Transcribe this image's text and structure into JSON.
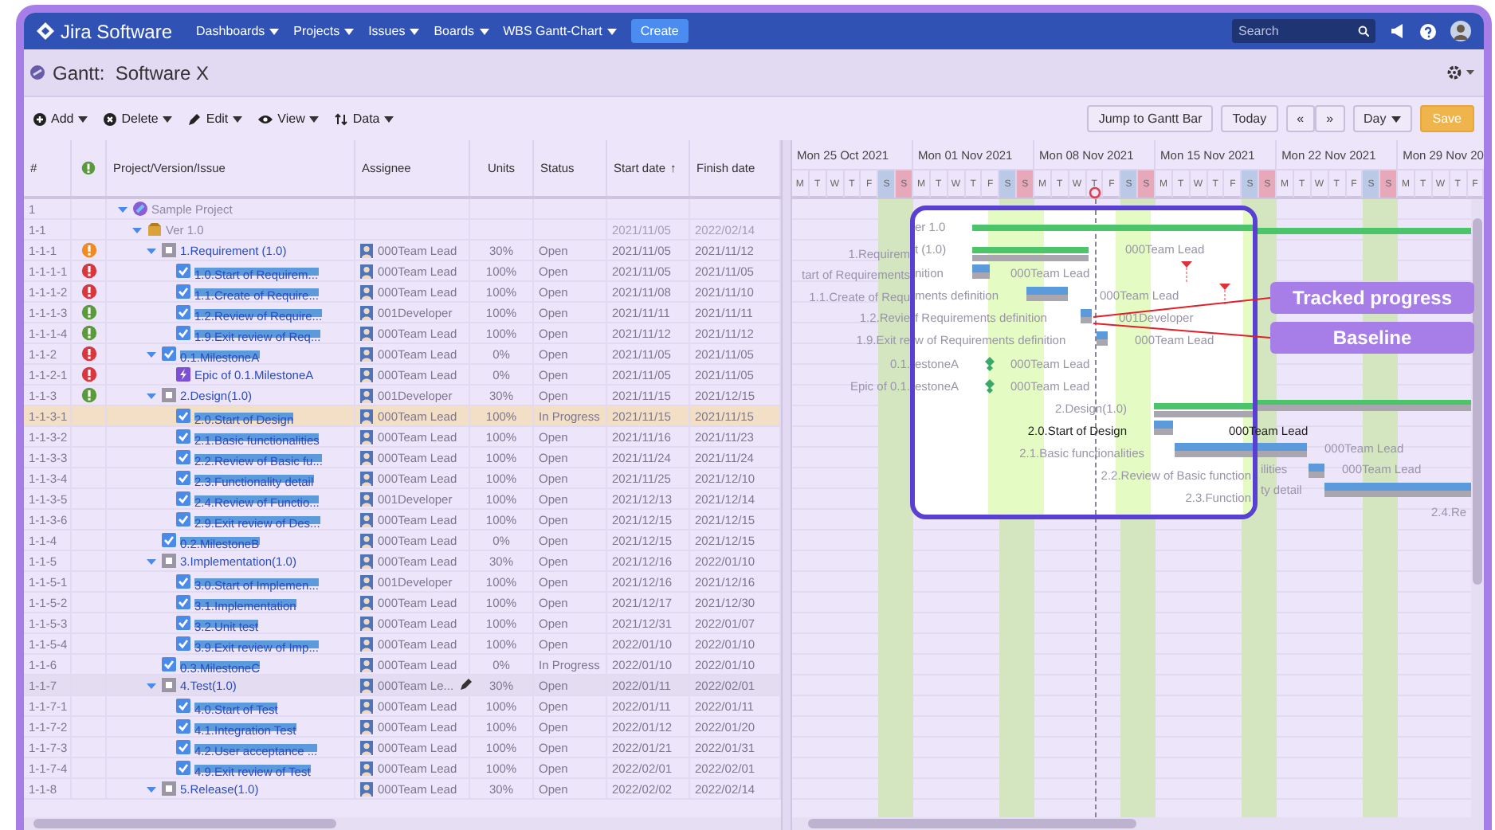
{
  "nav": {
    "product": "Jira Software",
    "menus": [
      {
        "label": "Dashboards"
      },
      {
        "label": "Projects"
      },
      {
        "label": "Issues"
      },
      {
        "label": "Boards"
      },
      {
        "label": "WBS Gantt-Chart"
      }
    ],
    "create_button": "Create",
    "search": {
      "placeholder": "Search"
    }
  },
  "page": {
    "title": "Gantt:  Software X"
  },
  "toolbar": {
    "menus": [
      {
        "kind": "add",
        "label": "Add"
      },
      {
        "kind": "delete",
        "label": "Delete"
      },
      {
        "kind": "edit",
        "label": "Edit"
      },
      {
        "kind": "view",
        "label": "View"
      },
      {
        "kind": "data",
        "label": "Data"
      }
    ],
    "jump_button": "Jump to Gantt Bar",
    "today_button": "Today",
    "prev_button": "«",
    "next_button": "»",
    "scale": "Day",
    "save_button": "Save"
  },
  "table": {
    "columns": [
      {
        "kind": "number",
        "label": "#"
      },
      {
        "kind": "priority"
      },
      {
        "kind": "issue",
        "label": "Project/Version/Issue"
      },
      {
        "kind": "assignee",
        "label": "Assignee"
      },
      {
        "kind": "units",
        "label": "Units"
      },
      {
        "kind": "status",
        "label": "Status"
      },
      {
        "kind": "start",
        "label": "Start date",
        "sort": "↑"
      },
      {
        "kind": "finish",
        "label": "Finish date"
      }
    ],
    "rows": [
      {
        "num": "1",
        "kind": "project",
        "name": "Sample Project",
        "expanded": true,
        "selected": false,
        "hovered": false,
        "children": [
          {
            "num": "1-1",
            "kind": "version",
            "name": "Ver 1.0",
            "expanded": true,
            "start": "2021/11/05",
            "finish": "2022/02/14",
            "selected": false,
            "hovered": false,
            "children": [
              {
                "num": "1-1-1",
                "color": "#f08a24",
                "kind": "folder",
                "name": "1.Requirement (1.0)",
                "expanded": true,
                "assignee": "000Team Lead",
                "units": "30%",
                "status": "Open",
                "start": "2021/11/05",
                "finish": "2021/11/12",
                "selected": false,
                "hovered": false,
                "children": [
                  {
                    "num": "1-1-1-1",
                    "color": "#d9373e",
                    "kind": "task",
                    "name": "1.0.Start of Requirem...",
                    "assignee": "000Team Lead",
                    "units": "100%",
                    "status": "Open",
                    "start": "2021/11/05",
                    "finish": "2021/11/05",
                    "selected": false,
                    "hovered": false
                  },
                  {
                    "num": "1-1-1-2",
                    "color": "#d9373e",
                    "kind": "task",
                    "name": "1.1.Create of Require...",
                    "assignee": "000Team Lead",
                    "units": "100%",
                    "status": "Open",
                    "start": "2021/11/08",
                    "finish": "2021/11/10",
                    "selected": false,
                    "hovered": false
                  },
                  {
                    "num": "1-1-1-3",
                    "color": "#5a9a3a",
                    "kind": "task",
                    "name": "1.2.Review of Require...",
                    "assignee": "001Developer",
                    "units": "100%",
                    "status": "Open",
                    "start": "2021/11/11",
                    "finish": "2021/11/11",
                    "selected": false,
                    "hovered": false
                  },
                  {
                    "num": "1-1-1-4",
                    "color": "#5a9a3a",
                    "kind": "task",
                    "name": "1.9.Exit review of Req...",
                    "assignee": "000Team Lead",
                    "units": "100%",
                    "status": "Open",
                    "start": "2021/11/12",
                    "finish": "2021/11/12",
                    "selected": false,
                    "hovered": false
                  }
                ]
              },
              {
                "num": "1-1-2",
                "color": "#d9373e",
                "kind": "task",
                "name": "0.1.MilestoneA",
                "expanded": true,
                "assignee": "000Team Lead",
                "units": "0%",
                "status": "Open",
                "start": "2021/11/05",
                "finish": "2021/11/05",
                "selected": false,
                "hovered": false,
                "children": [
                  {
                    "num": "1-1-2-1",
                    "color": "#d9373e",
                    "kind": "epic",
                    "name": "Epic of 0.1.MilestoneA",
                    "assignee": "000Team Lead",
                    "units": "0%",
                    "status": "Open",
                    "start": "2021/11/05",
                    "finish": "2021/11/05",
                    "selected": false,
                    "hovered": false
                  }
                ]
              },
              {
                "num": "1-1-3",
                "color": "#5a9a3a",
                "kind": "folder",
                "name": "2.Design(1.0)",
                "expanded": true,
                "assignee": "001Developer",
                "units": "30%",
                "status": "Open",
                "start": "2021/11/15",
                "finish": "2021/12/15",
                "selected": false,
                "hovered": false,
                "children": [
                  {
                    "num": "1-1-3-1",
                    "kind": "task",
                    "name": "2.0.Start of Design",
                    "assignee": "000Team Lead",
                    "units": "100%",
                    "status": "In Progress",
                    "start": "2021/11/15",
                    "finish": "2021/11/15",
                    "selected": true,
                    "hovered": false
                  },
                  {
                    "num": "1-1-3-2",
                    "kind": "task",
                    "name": "2.1.Basic functionalities",
                    "assignee": "000Team Lead",
                    "units": "100%",
                    "status": "Open",
                    "start": "2021/11/16",
                    "finish": "2021/11/23",
                    "selected": false,
                    "hovered": false
                  },
                  {
                    "num": "1-1-3-3",
                    "kind": "task",
                    "name": "2.2.Review of Basic fu...",
                    "assignee": "000Team Lead",
                    "units": "100%",
                    "status": "Open",
                    "start": "2021/11/24",
                    "finish": "2021/11/24",
                    "selected": false,
                    "hovered": false
                  },
                  {
                    "num": "1-1-3-4",
                    "kind": "task",
                    "name": "2.3.Functionality detail",
                    "assignee": "000Team Lead",
                    "units": "100%",
                    "status": "Open",
                    "start": "2021/11/25",
                    "finish": "2021/12/10",
                    "selected": false,
                    "hovered": false
                  },
                  {
                    "num": "1-1-3-5",
                    "kind": "task",
                    "name": "2.4.Review of Functio...",
                    "assignee": "001Developer",
                    "units": "100%",
                    "status": "Open",
                    "start": "2021/12/13",
                    "finish": "2021/12/14",
                    "selected": false,
                    "hovered": false
                  },
                  {
                    "num": "1-1-3-6",
                    "kind": "task",
                    "name": "2.9.Exit review of Des...",
                    "assignee": "000Team Lead",
                    "units": "100%",
                    "status": "Open",
                    "start": "2021/12/15",
                    "finish": "2021/12/15",
                    "selected": false,
                    "hovered": false
                  }
                ]
              },
              {
                "num": "1-1-4",
                "kind": "task",
                "name": "0.2.MilestoneB",
                "assignee": "000Team Lead",
                "units": "0%",
                "status": "Open",
                "start": "2021/12/15",
                "finish": "2021/12/15",
                "selected": false,
                "hovered": false
              },
              {
                "num": "1-1-5",
                "kind": "folder",
                "name": "3.Implementation(1.0)",
                "expanded": true,
                "assignee": "000Team Lead",
                "units": "30%",
                "status": "Open",
                "start": "2021/12/16",
                "finish": "2022/01/10",
                "selected": false,
                "hovered": false,
                "children": [
                  {
                    "num": "1-1-5-1",
                    "kind": "task",
                    "name": "3.0.Start of Implemen...",
                    "assignee": "001Developer",
                    "units": "100%",
                    "status": "Open",
                    "start": "2021/12/16",
                    "finish": "2021/12/16",
                    "selected": false,
                    "hovered": false
                  },
                  {
                    "num": "1-1-5-2",
                    "kind": "task",
                    "name": "3.1.Implementation",
                    "assignee": "000Team Lead",
                    "units": "100%",
                    "status": "Open",
                    "start": "2021/12/17",
                    "finish": "2021/12/30",
                    "selected": false,
                    "hovered": false
                  },
                  {
                    "num": "1-1-5-3",
                    "kind": "task",
                    "name": "3.2.Unit test",
                    "assignee": "000Team Lead",
                    "units": "100%",
                    "status": "Open",
                    "start": "2021/12/31",
                    "finish": "2022/01/07",
                    "selected": false,
                    "hovered": false
                  },
                  {
                    "num": "1-1-5-4",
                    "kind": "task",
                    "name": "3.9.Exit review of Imp...",
                    "assignee": "000Team Lead",
                    "units": "100%",
                    "status": "Open",
                    "start": "2022/01/10",
                    "finish": "2022/01/10",
                    "selected": false,
                    "hovered": false
                  }
                ]
              },
              {
                "num": "1-1-6",
                "kind": "task",
                "name": "0.3.MilestoneC",
                "assignee": "000Team Lead",
                "units": "0%",
                "status": "In Progress",
                "start": "2022/01/10",
                "finish": "2022/01/10",
                "selected": false,
                "hovered": false
              },
              {
                "num": "1-1-7",
                "kind": "folder",
                "name": "4.Test(1.0)",
                "expanded": true,
                "assignee": "000Team Le...",
                "units": "30%",
                "status": "Open",
                "start": "2022/01/11",
                "finish": "2022/02/01",
                "selected": false,
                "hovered": true,
                "children": [
                  {
                    "num": "1-1-7-1",
                    "kind": "task",
                    "name": "4.0.Start of Test",
                    "assignee": "000Team Lead",
                    "units": "100%",
                    "status": "Open",
                    "start": "2022/01/11",
                    "finish": "2022/01/11",
                    "selected": false,
                    "hovered": false
                  },
                  {
                    "num": "1-1-7-2",
                    "kind": "task",
                    "name": "4.1.Integration Test",
                    "assignee": "000Team Lead",
                    "units": "100%",
                    "status": "Open",
                    "start": "2022/01/12",
                    "finish": "2022/01/20",
                    "selected": false,
                    "hovered": false
                  },
                  {
                    "num": "1-1-7-3",
                    "kind": "task",
                    "name": "4.2.User acceptance ...",
                    "assignee": "000Team Lead",
                    "units": "100%",
                    "status": "Open",
                    "start": "2022/01/21",
                    "finish": "2022/01/31",
                    "selected": false,
                    "hovered": false
                  },
                  {
                    "num": "1-1-7-4",
                    "kind": "task",
                    "name": "4.9.Exit review of Test",
                    "assignee": "000Team Lead",
                    "units": "100%",
                    "status": "Open",
                    "start": "2022/02/01",
                    "finish": "2022/02/01",
                    "selected": false,
                    "hovered": false
                  }
                ]
              },
              {
                "num": "1-1-8",
                "kind": "folder",
                "name": "5.Release(1.0)",
                "expanded": true,
                "assignee": "000Team Lead",
                "units": "30%",
                "status": "Open",
                "start": "2022/02/02",
                "finish": "2022/02/14",
                "selected": false,
                "hovered": false
              }
            ]
          }
        ]
      }
    ]
  },
  "gantt": {
    "weeks": [
      {
        "label": "Mon 25 Oct 2021",
        "days": [
          "M",
          "T",
          "W",
          "T",
          "F",
          "S",
          "S"
        ]
      },
      {
        "label": "Mon 01 Nov 2021",
        "days": [
          "M",
          "T",
          "W",
          "T",
          "F",
          "S",
          "S"
        ]
      },
      {
        "label": "Mon 08 Nov 2021",
        "days": [
          "M",
          "T",
          "W",
          "T",
          "F",
          "S",
          "S"
        ]
      },
      {
        "label": "Mon 15 Nov 2021",
        "days": [
          "M",
          "T",
          "W",
          "T",
          "F",
          "S",
          "S"
        ]
      },
      {
        "label": "Mon 22 Nov 2021",
        "days": [
          "M",
          "T",
          "W",
          "T",
          "F",
          "S",
          "S"
        ]
      },
      {
        "label": "Mon 29 Nov 20",
        "days": [
          "M",
          "T",
          "W",
          "T",
          "F"
        ]
      }
    ],
    "left_labels": [
      "1.Requirem",
      "tart of Requirements",
      "1.1.Create of Requ",
      "1.2.Revie",
      "1.9.Exit re",
      "0.1.",
      "Epic of 0.1."
    ],
    "zoom_labels": [
      {
        "text": "er 1.0",
        "selected": false
      },
      {
        "text": "t (1.0)",
        "selected": false
      },
      {
        "text": "nition",
        "selected": false
      },
      {
        "text": "ments definition",
        "selected": false
      },
      {
        "text": "f Requirements definition",
        "selected": false
      },
      {
        "text": "w of Requirements definition",
        "selected": false
      },
      {
        "text": "estoneA",
        "selected": false
      },
      {
        "text": "estoneA",
        "selected": false
      },
      {
        "text": "2.Design(1.0)",
        "selected": false
      },
      {
        "text": "2.0.Start of Design",
        "selected": true
      },
      {
        "text": "2.1.Basic functionalities",
        "selected": false
      },
      {
        "text": "2.2.Review of Basic function",
        "selected": false
      },
      {
        "text": "2.3.Function",
        "selected": false
      }
    ],
    "zoom_assignees": [
      "000Team Lead",
      "000Team Lead",
      "000Team Lead",
      "001Developer",
      "000Team Lead",
      "000Team Lead",
      "000Team Lead"
    ],
    "right_labels": [
      "000Team Lead",
      "000Team Lead",
      "ilities",
      "000Team Lead",
      "ty detail",
      "2.4.Re"
    ],
    "callouts": [
      {
        "text": "Tracked progress"
      },
      {
        "text": "Baseline"
      }
    ]
  }
}
